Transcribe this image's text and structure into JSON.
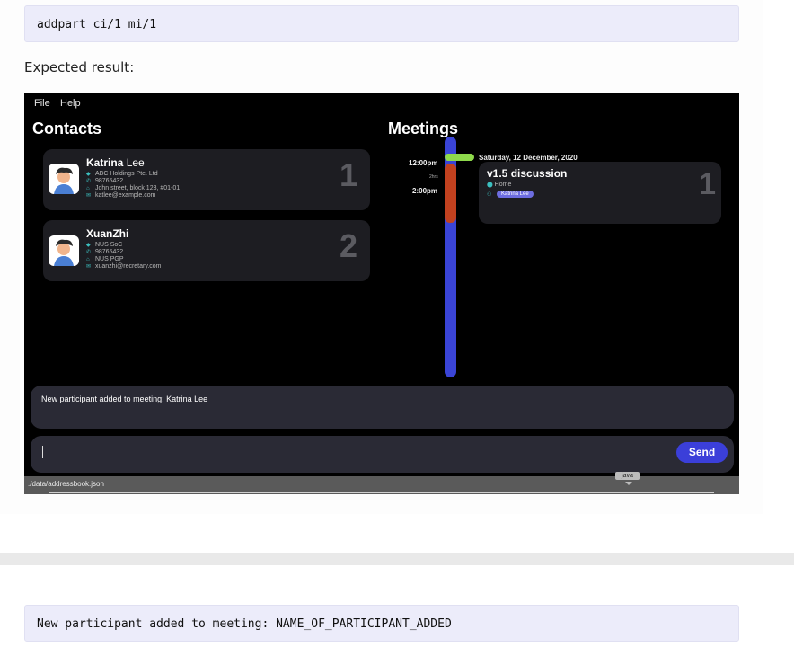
{
  "doc": {
    "command_code": "addpart ci/1 mi/1",
    "expected_label": "Expected result:",
    "message_code": "New participant added to meeting: NAME_OF_PARTICIPANT_ADDED"
  },
  "app": {
    "menu": [
      "File",
      "Help"
    ],
    "contacts_title": "Contacts",
    "meetings_title": "Meetings",
    "contacts": [
      {
        "first_name": "Katrina",
        "last_name": "Lee",
        "company": "ABC Holdings Pte. Ltd",
        "phone": "98765432",
        "address": "John street, block 123, #01-01",
        "email": "katlee@example.com",
        "index": "1"
      },
      {
        "first_name": "XuanZhi",
        "last_name": "",
        "company": "NUS SoC",
        "phone": "98765432",
        "address": "NUS PGP",
        "email": "xuanzhi@recretary.com",
        "index": "2"
      }
    ],
    "timeline": {
      "date": "Saturday, 12 December, 2020",
      "start_time": "12:00pm",
      "duration": "2hrs",
      "end_time": "2:00pm",
      "track_color": "#3a44d6",
      "event_color": "#c2411f",
      "flag_color": "#8ed94b"
    },
    "meeting": {
      "title": "v1.5 discussion",
      "location": "Home",
      "participant": "Katrina Lee",
      "index": "1"
    },
    "result_message": "New participant added to meeting: Katrina Lee",
    "send_label": "Send",
    "status_path": "./data/addressbook.json",
    "tooltip": "java"
  },
  "colors": {
    "app_background": "#000000",
    "card_background": "#1d1d22",
    "panel_background": "#2a2a35",
    "send_button": "#3b3fd9",
    "code_background": "#ececfa"
  }
}
